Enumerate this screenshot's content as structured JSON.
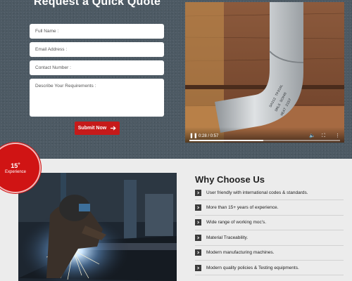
{
  "quote": {
    "title": "Request a Quick Quote",
    "fields": {
      "full_name": "Full Name :",
      "email": "Email Address :",
      "contact": "Contact Number :",
      "requirements": "Describe Your Requirements :"
    },
    "submit_label": "Submit Now"
  },
  "video": {
    "time": "0:28 / 0:57",
    "progress": 0.49,
    "icons": [
      "pause-icon",
      "volume-icon",
      "fullscreen-icon",
      "more-options-icon"
    ]
  },
  "badge": {
    "number": "15",
    "sup": "+",
    "label": "Experience"
  },
  "why": {
    "title": "Why Choose Us",
    "items": [
      "User friendly with international codes & standards.",
      "More than 15+ years of experience.",
      "Wide range of working moc's.",
      "Material Traceability.",
      "Modern manufacturing machines.",
      "Modern quality policies & Testing equipments."
    ]
  },
  "colors": {
    "accent": "#c61a1a",
    "section_bg": "#4d5a64",
    "bullet": "#3a3a3a"
  }
}
